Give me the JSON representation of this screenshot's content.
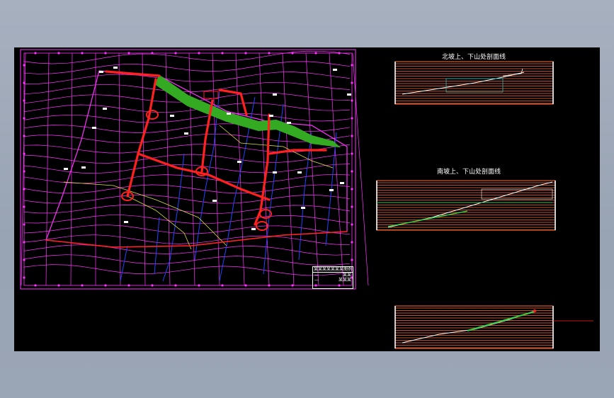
{
  "app": {
    "background": "#a7b0bf",
    "canvas_bg": "#000000"
  },
  "colors": {
    "contour": "#ff33ff",
    "road": "#ff2020",
    "slope": "#33aa22",
    "stream": "#2244ff",
    "boundary": "#ff33ff",
    "section_lines": "#ff6a3a",
    "profile": "#ffffff",
    "ground": "#33cc44"
  },
  "sections": {
    "north": {
      "title": "北坡上、下山处剖面线"
    },
    "south": {
      "title": "南坡上、下山处剖面线"
    },
    "third": {
      "title": ""
    }
  },
  "legend": {
    "title": "某某某某某某某图例",
    "rows": [
      {
        "k": "—",
        "v": "某某"
      },
      {
        "k": "—",
        "v": "某某某"
      }
    ]
  },
  "plan": {
    "annotation_icon": "tree-marker-icon"
  }
}
